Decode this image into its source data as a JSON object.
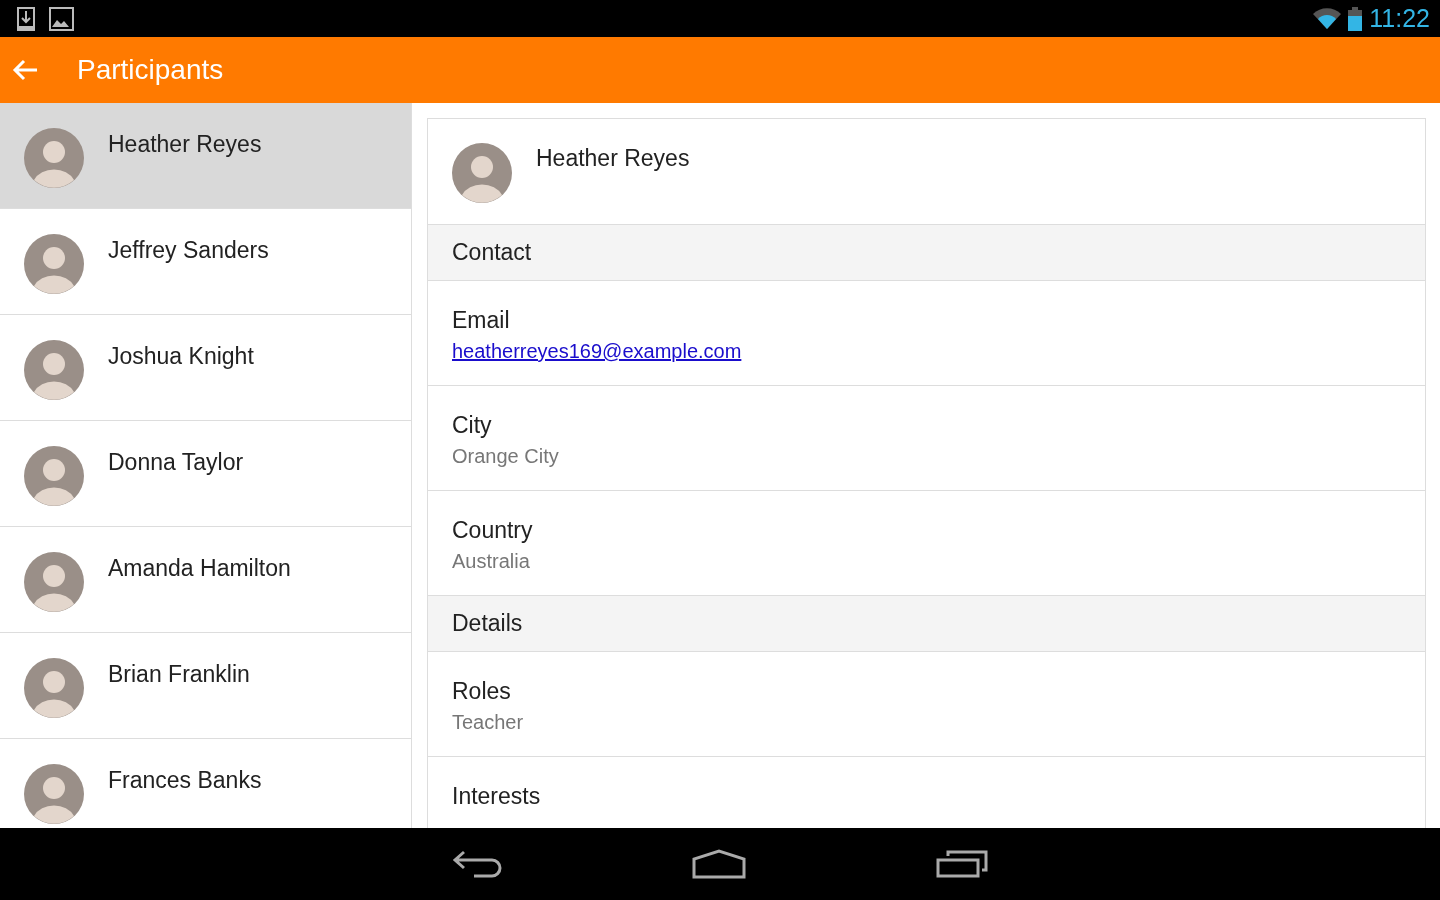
{
  "status_bar": {
    "time": "11:22"
  },
  "app_bar": {
    "title": "Participants"
  },
  "participants": [
    {
      "name": "Heather Reyes",
      "selected": true
    },
    {
      "name": "Jeffrey Sanders",
      "selected": false
    },
    {
      "name": "Joshua Knight",
      "selected": false
    },
    {
      "name": "Donna Taylor",
      "selected": false
    },
    {
      "name": "Amanda Hamilton",
      "selected": false
    },
    {
      "name": "Brian Franklin",
      "selected": false
    },
    {
      "name": "Frances Banks",
      "selected": false
    }
  ],
  "detail": {
    "name": "Heather Reyes",
    "rows": [
      {
        "kind": "section",
        "label": "Contact"
      },
      {
        "kind": "link",
        "label": "Email",
        "value": "heatherreyes169@example.com"
      },
      {
        "kind": "field",
        "label": "City",
        "value": "Orange City"
      },
      {
        "kind": "field",
        "label": "Country",
        "value": "Australia"
      },
      {
        "kind": "section",
        "label": "Details"
      },
      {
        "kind": "field",
        "label": "Roles",
        "value": "Teacher"
      },
      {
        "kind": "field",
        "label": "Interests"
      }
    ]
  }
}
